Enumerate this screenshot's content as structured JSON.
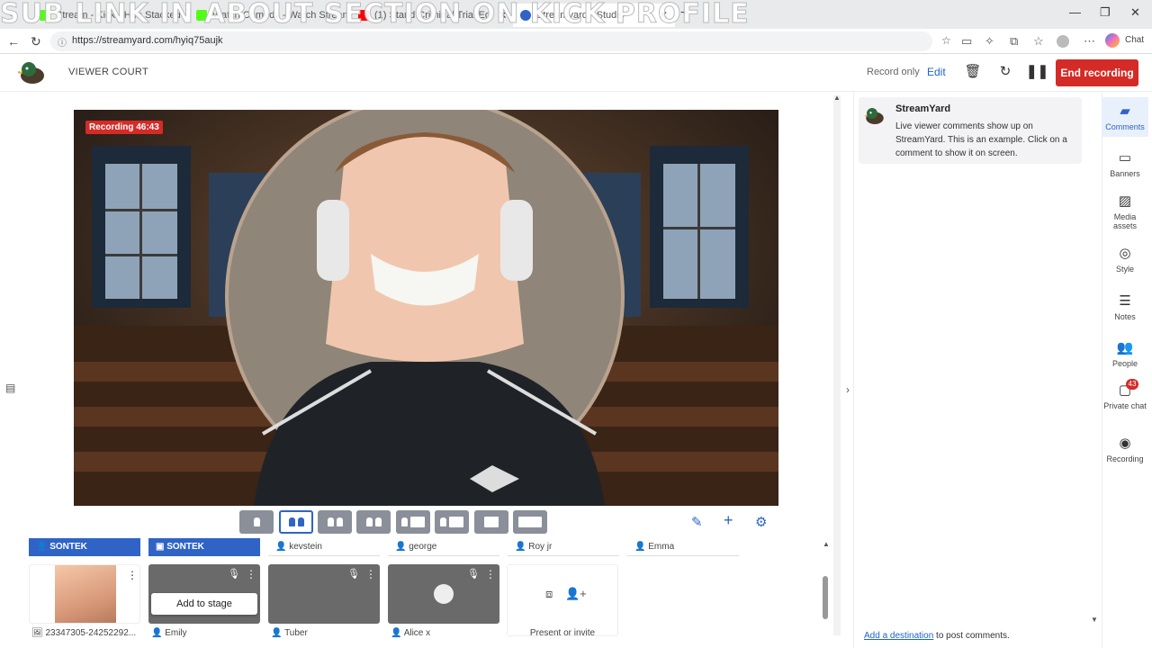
{
  "browser": {
    "tabs": [
      {
        "label": "Stream - Kick - Hub Stacked",
        "favicon_color": "#53fc18"
      },
      {
        "label": "Watch Comedy - Watch Streams on K",
        "favicon_color": "#53fc18"
      },
      {
        "label": "(1) Stand Criminal Trial Edi",
        "favicon_color": "#ff0000"
      },
      {
        "label": "Streamyard - Studio",
        "favicon_color": "#2f64c6"
      }
    ],
    "watermark": "SUB LINK IN ABOUT SECTION ON KICK PROFILE",
    "url": "https://streamyard.com/hyiq75aujk",
    "chat_label": "Chat"
  },
  "header": {
    "title": "VIEWER COURT",
    "record_only": "Record only",
    "edit": "Edit",
    "end_recording": "End recording"
  },
  "stage": {
    "recording_badge": "Recording 46:43"
  },
  "participants": {
    "labels": [
      {
        "name": "SONTEK",
        "style": "blue"
      },
      {
        "name": "SONTEK",
        "style": "blue"
      },
      {
        "name": "kevstein",
        "style": "gray"
      },
      {
        "name": "george",
        "style": "gray"
      },
      {
        "name": "Roy jr",
        "style": "gray"
      },
      {
        "name": "Emma",
        "style": "gray"
      }
    ],
    "cards": [
      {
        "name": "23347305-24252292..."
      },
      {
        "name": "Emily"
      },
      {
        "name": "Tuber"
      },
      {
        "name": "Alice x"
      }
    ],
    "add_to_stage": "Add to stage",
    "present_or_invite": "Present or invite"
  },
  "comments": {
    "author": "StreamYard",
    "text": "Live viewer comments show up on StreamYard. This is an example. Click on a comment to show it on screen.",
    "add_destination": "Add a destination",
    "add_destination_suffix": " to post comments."
  },
  "sidebar": {
    "items": [
      {
        "label": "Comments",
        "icon": "comment-icon",
        "active": true
      },
      {
        "label": "Banners",
        "icon": "banner-icon"
      },
      {
        "label": "Media assets",
        "icon": "media-icon"
      },
      {
        "label": "Style",
        "icon": "palette-icon"
      },
      {
        "label": "Notes",
        "icon": "notes-icon"
      },
      {
        "label": "People",
        "icon": "people-icon"
      },
      {
        "label": "Private chat",
        "icon": "chat-icon",
        "badge": "43"
      },
      {
        "label": "Recording",
        "icon": "record-icon"
      }
    ]
  },
  "colors": {
    "accent": "#2f64c6",
    "danger": "#d42b27"
  }
}
